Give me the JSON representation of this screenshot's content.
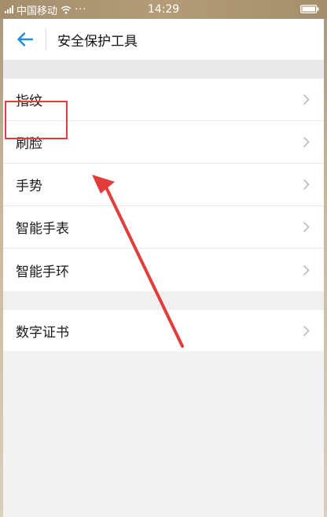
{
  "status_bar": {
    "carrier": "中国移动",
    "dots": "···",
    "time": "14:29"
  },
  "header": {
    "title": "安全保护工具"
  },
  "sections": [
    {
      "items": [
        {
          "label": "指纹"
        },
        {
          "label": "刷脸"
        },
        {
          "label": "手势"
        },
        {
          "label": "智能手表"
        },
        {
          "label": "智能手环"
        }
      ]
    },
    {
      "items": [
        {
          "label": "数字证书"
        }
      ]
    }
  ],
  "icons": {
    "back": "back-arrow-icon",
    "chevron": "chevron-right-icon"
  },
  "colors": {
    "accent": "#1f8ce0",
    "annotation": "#e23c3c"
  }
}
